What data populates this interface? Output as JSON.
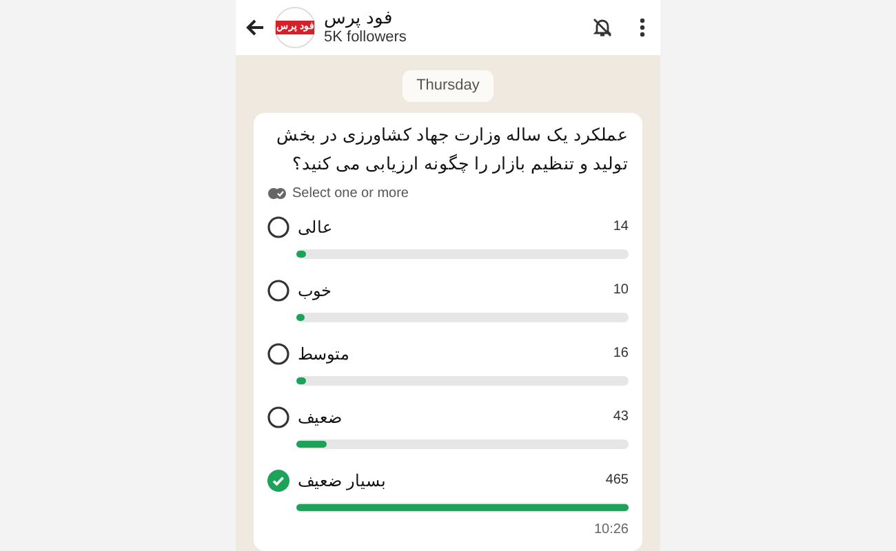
{
  "header": {
    "channel_name": "فود پرس",
    "followers": "5K followers",
    "logo_text": "فود پرس"
  },
  "date_chip": "Thursday",
  "poll": {
    "question": "عملکرد یک ساله وزارت جهاد کشاورزی در بخش تولید و تنظیم بازار را چگونه ارزیابی می کنید؟",
    "hint": "Select one or more",
    "options": [
      {
        "label": "عالی",
        "count": "14",
        "level": 0.03,
        "selected": false
      },
      {
        "label": "خوب",
        "count": "10",
        "level": 0.02,
        "selected": false
      },
      {
        "label": "متوسط",
        "count": "16",
        "level": 0.03,
        "selected": false
      },
      {
        "label": "ضعیف",
        "count": "43",
        "level": 0.09,
        "selected": false
      },
      {
        "label": "بسیار ضعیف",
        "count": "465",
        "level": 1,
        "selected": true
      }
    ],
    "time": "10:26"
  }
}
